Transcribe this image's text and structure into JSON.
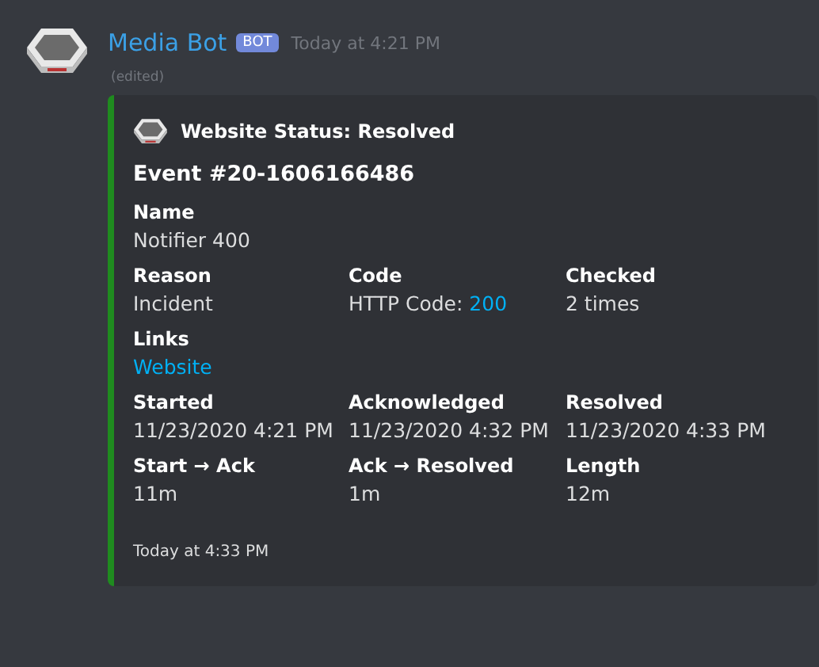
{
  "message": {
    "username": "Media Bot",
    "badge": "BOT",
    "timestamp": "Today at 4:21 PM",
    "edited": "(edited)"
  },
  "embed": {
    "color": "#1f8b1f",
    "author": "Website Status: Resolved",
    "title": "Event #20-1606166486",
    "fields": [
      {
        "name": "Name",
        "value": "Notifier 400",
        "inline": false
      },
      {
        "name": "Reason",
        "value": "Incident",
        "inline": true
      },
      {
        "name": "Code",
        "value": "HTTP Code:",
        "link": "200",
        "inline": true
      },
      {
        "name": "Checked",
        "value": "2 times",
        "inline": true
      },
      {
        "name": "Links",
        "link": "Website",
        "inline": false
      },
      {
        "name": "Started",
        "value": "11/23/2020 4:21 PM",
        "inline": true
      },
      {
        "name": "Acknowledged",
        "value": "11/23/2020 4:32 PM",
        "inline": true
      },
      {
        "name": "Resolved",
        "value": "11/23/2020 4:33 PM",
        "inline": true
      },
      {
        "name": "Start → Ack",
        "value": "11m",
        "inline": true
      },
      {
        "name": "Ack → Resolved",
        "value": "1m",
        "inline": true
      },
      {
        "name": "Length",
        "value": "12m",
        "inline": true
      }
    ],
    "footer": "Today at 4:33 PM"
  }
}
